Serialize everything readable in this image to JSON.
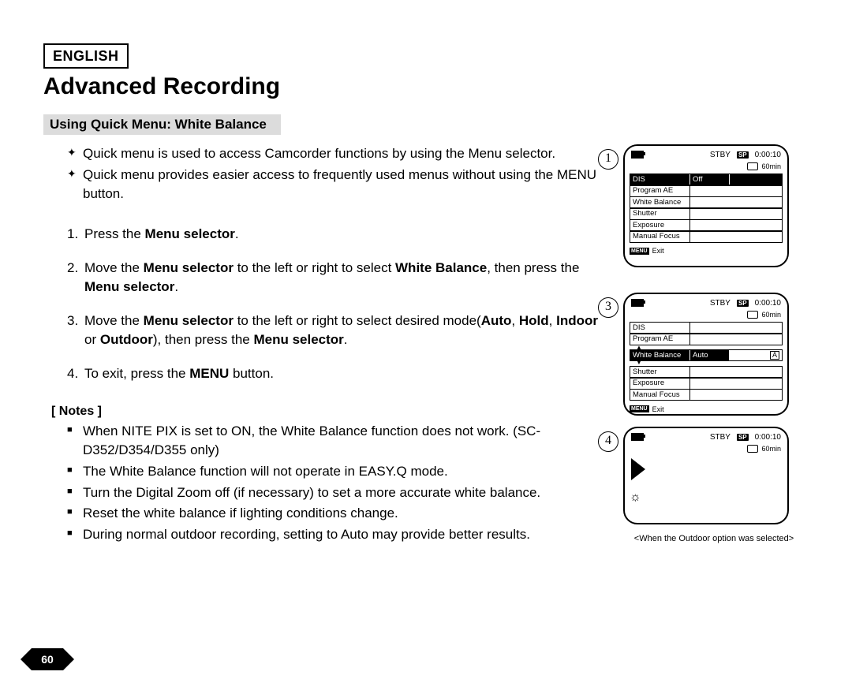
{
  "lang_badge": "ENGLISH",
  "title": "Advanced Recording",
  "section_heading": "Using Quick Menu: White Balance",
  "intro": {
    "items": [
      "Quick menu is used to access Camcorder functions by using the Menu selector.",
      "Quick menu provides easier access to frequently used menus without using the MENU button."
    ]
  },
  "steps": {
    "s1_a": "Press the ",
    "s1_b": "Menu selector",
    "s1_c": ".",
    "s2_a": "Move the ",
    "s2_b": "Menu selector",
    "s2_c": " to the left or right to select ",
    "s2_d": "White Balance",
    "s2_e": ", then press the ",
    "s2_f": "Menu selector",
    "s2_g": ".",
    "s3_a": "Move the ",
    "s3_b": "Menu selector",
    "s3_c": " to the left or right to select desired mode(",
    "s3_d": "Auto",
    "s3_e": ", ",
    "s3_f": "Hold",
    "s3_g": ", ",
    "s3_h": "Indoor",
    "s3_i": " or ",
    "s3_j": "Outdoor",
    "s3_k": "), then press the ",
    "s3_l": "Menu selector",
    "s3_m": ".",
    "s4_a": "To exit, press the ",
    "s4_b": "MENU",
    "s4_c": " button."
  },
  "notes_label": "[ Notes ]",
  "notes": {
    "items": [
      "When NITE PIX is set to ON, the White Balance function does not work. (SC-D352/D354/D355 only)",
      "The White Balance function will not operate in EASY.Q mode.",
      "Turn the Digital Zoom off (if necessary) to set a more accurate white balance.",
      "Reset the white balance if lighting conditions change.",
      "During normal outdoor recording, setting to Auto may provide better results."
    ]
  },
  "screens": {
    "stby": "STBY",
    "sp": "SP",
    "timecode": "0:00:10",
    "remaining": "60min",
    "exit": "Exit",
    "menu_tag": "MENU",
    "rows": {
      "dis": "DIS",
      "program_ae": "Program AE",
      "white_balance": "White Balance",
      "shutter": "Shutter",
      "exposure": "Exposure",
      "manual_focus": "Manual Focus"
    },
    "dis_off": "Off",
    "wb_auto": "Auto",
    "wb_icon": "A"
  },
  "fig_labels": {
    "f1": "1",
    "f3": "3",
    "f4": "4"
  },
  "caption": "<When the Outdoor option was selected>",
  "page_number": "60"
}
